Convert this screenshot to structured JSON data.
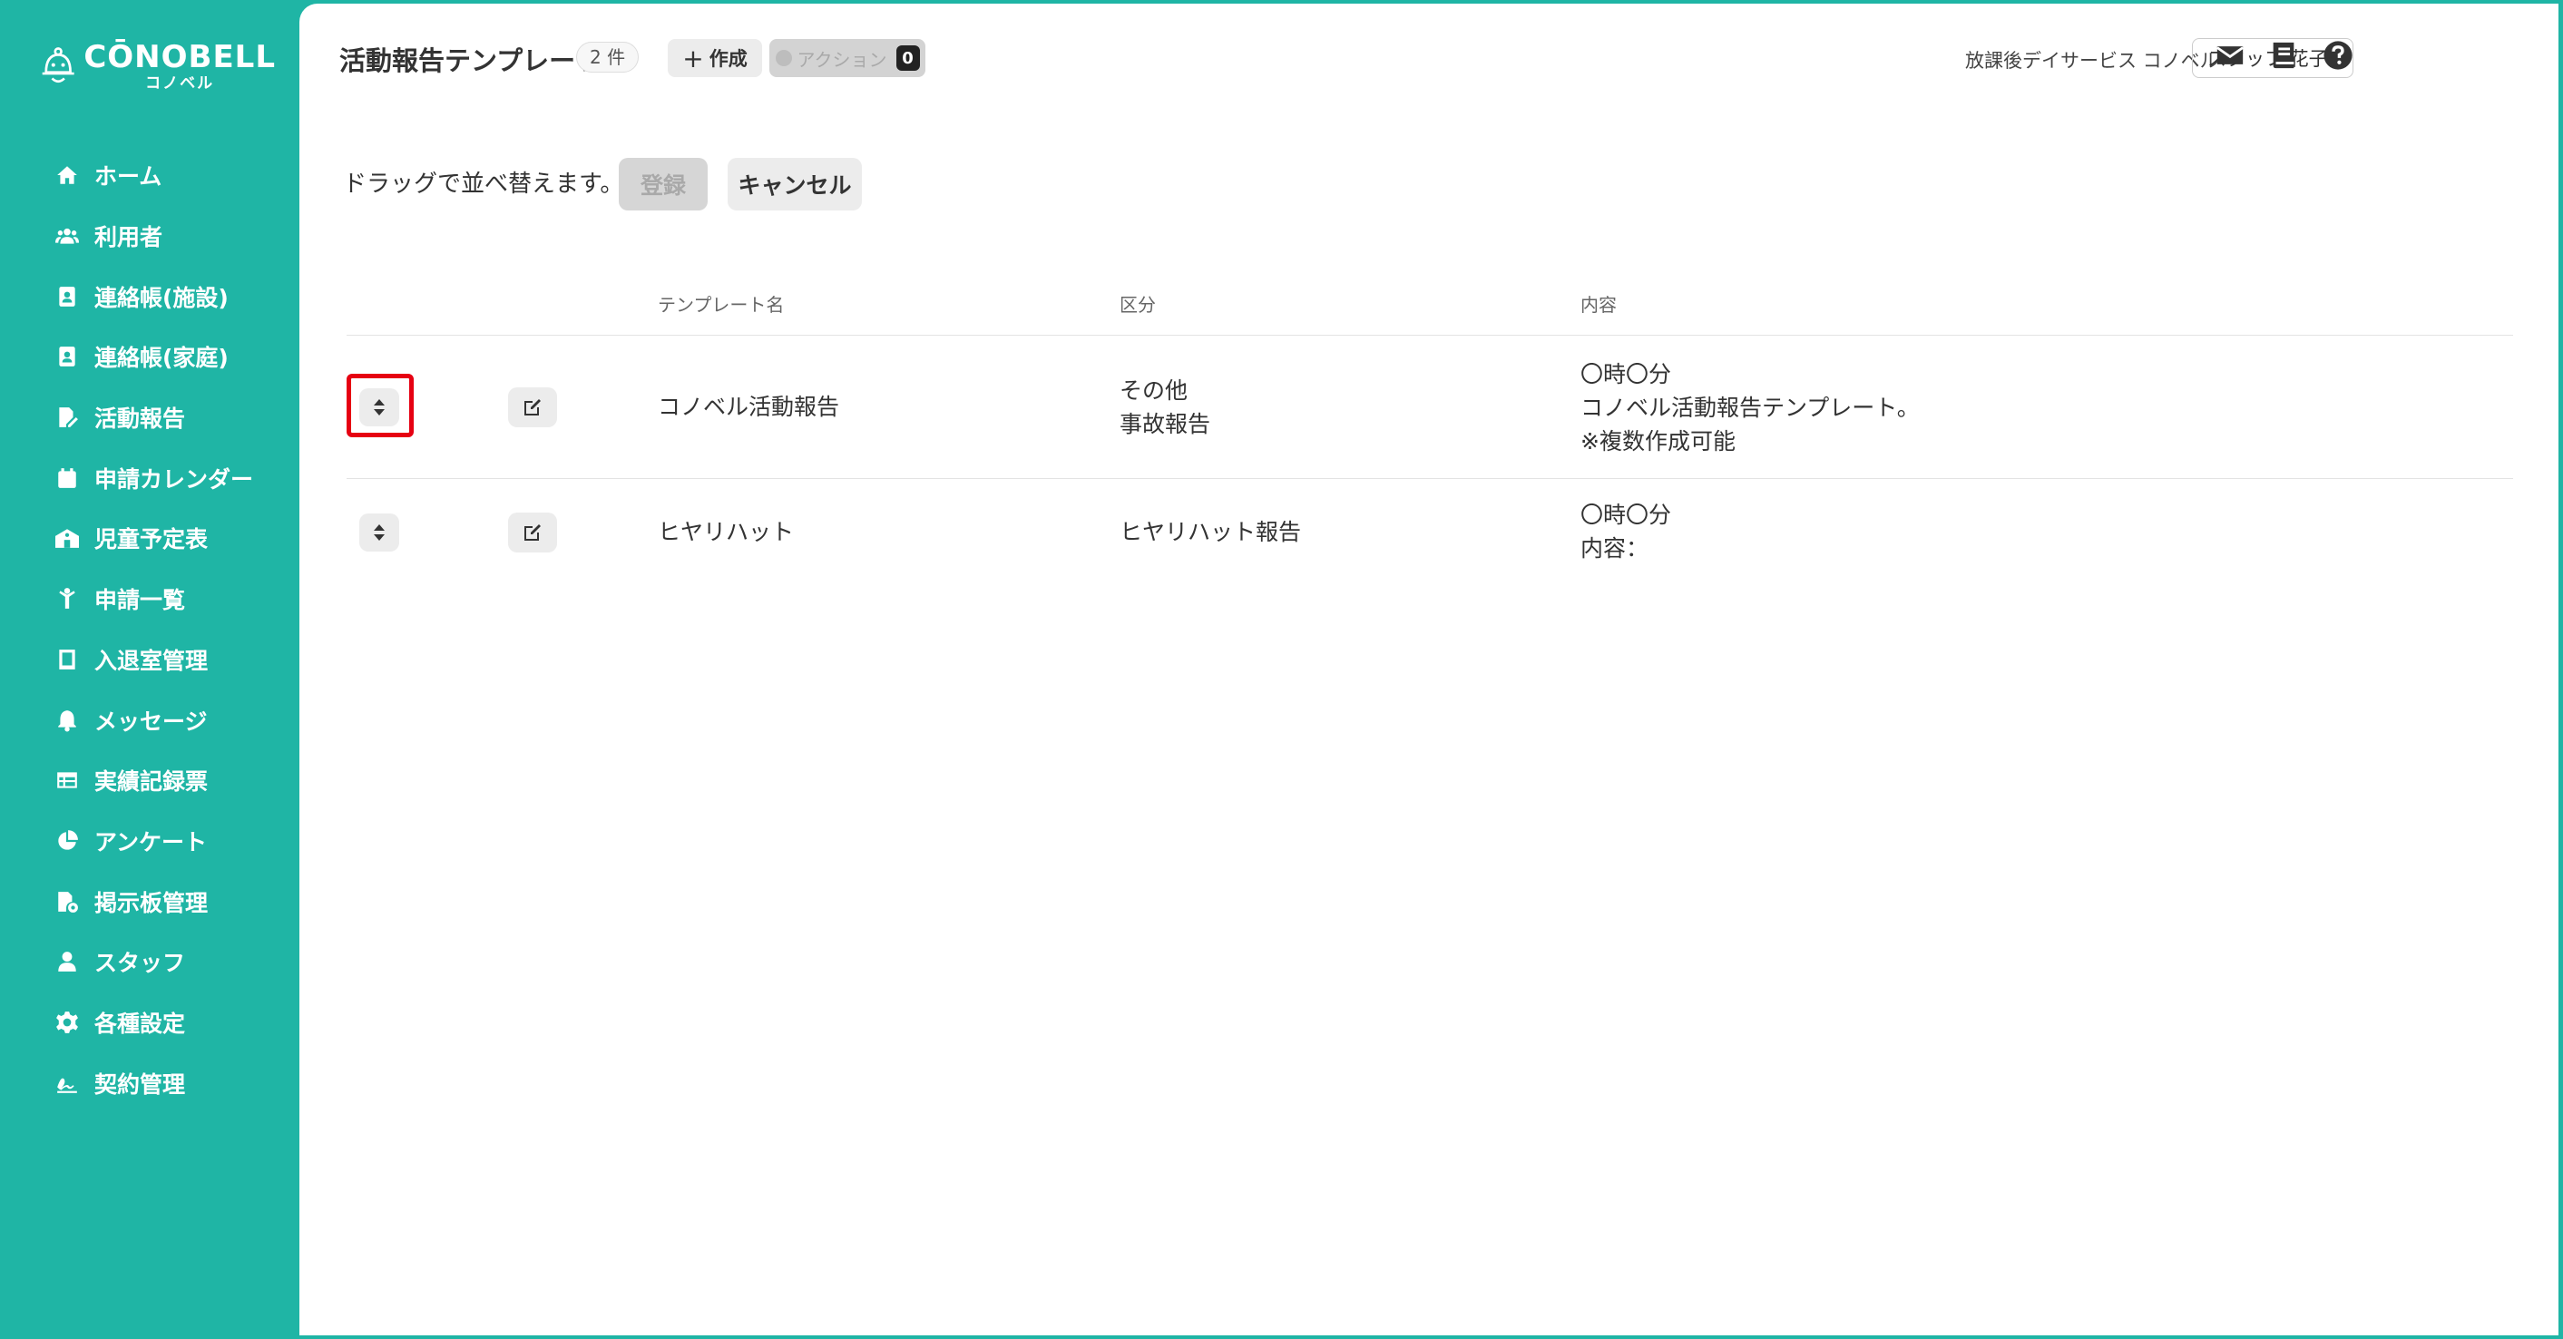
{
  "brand": {
    "name": "CŌNOBELL",
    "sub": "コノベル"
  },
  "sidebar": {
    "items": [
      {
        "label": "ホーム",
        "icon": "home-icon"
      },
      {
        "label": "利用者",
        "icon": "users-icon"
      },
      {
        "label": "連絡帳(施設)",
        "icon": "contact-book-icon"
      },
      {
        "label": "連絡帳(家庭)",
        "icon": "contact-book-icon"
      },
      {
        "label": "活動報告",
        "icon": "file-pen-icon"
      },
      {
        "label": "申請カレンダー",
        "icon": "calendar-icon"
      },
      {
        "label": "児童予定表",
        "icon": "school-icon"
      },
      {
        "label": "申請一覧",
        "icon": "child-icon"
      },
      {
        "label": "入退室管理",
        "icon": "tablet-icon"
      },
      {
        "label": "メッセージ",
        "icon": "bell-icon"
      },
      {
        "label": "実績記録票",
        "icon": "table-icon"
      },
      {
        "label": "アンケート",
        "icon": "pie-chart-icon"
      },
      {
        "label": "掲示板管理",
        "icon": "file-settings-icon"
      },
      {
        "label": "スタッフ",
        "icon": "user-icon"
      },
      {
        "label": "各種設定",
        "icon": "gear-icon"
      },
      {
        "label": "契約管理",
        "icon": "signature-icon"
      }
    ]
  },
  "header": {
    "title": "活動報告テンプレート",
    "count": "2 件",
    "create_label": "作成",
    "action_label": "アクション",
    "action_count": "0",
    "facility": "放課後デイサービス コノベル",
    "staff": "スタッフ 花子"
  },
  "toolbar": {
    "hint": "ドラッグで並べ替えます。",
    "register_label": "登録",
    "cancel_label": "キャンセル"
  },
  "table": {
    "columns": {
      "name": "テンプレート名",
      "category": "区分",
      "content": "内容"
    },
    "rows": [
      {
        "name": "コノベル活動報告",
        "category": [
          "その他",
          "事故報告"
        ],
        "content": [
          "〇時〇分",
          "コノベル活動報告テンプレート。",
          "※複数作成可能"
        ]
      },
      {
        "name": "ヒヤリハット",
        "category": [
          "ヒヤリハット報告"
        ],
        "content": [
          "〇時〇分",
          "内容："
        ]
      }
    ]
  },
  "colors": {
    "sidebar": "#1fb5a5",
    "highlight": "#e60012"
  }
}
